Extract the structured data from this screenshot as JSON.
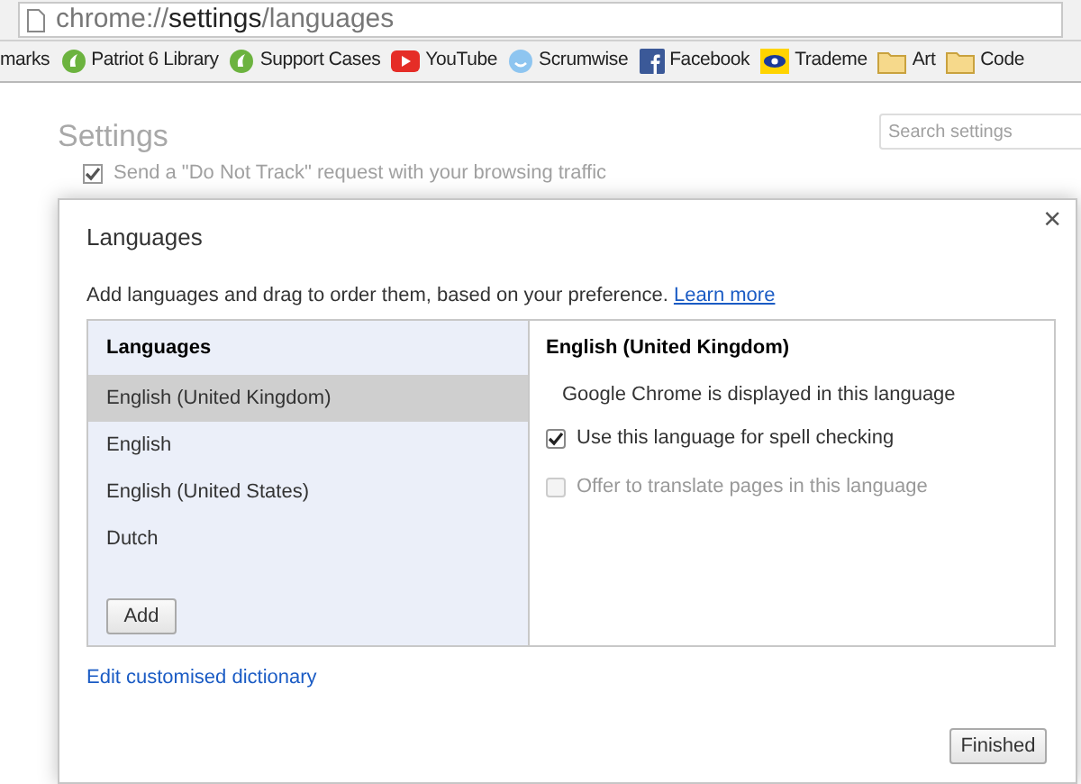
{
  "address_bar": {
    "scheme": "chrome://",
    "host": "settings",
    "path": "/languages"
  },
  "bookmarks": [
    {
      "label": "marks",
      "kind": "none"
    },
    {
      "label": "Patriot 6 Library",
      "kind": "green"
    },
    {
      "label": "Support Cases",
      "kind": "green"
    },
    {
      "label": "YouTube",
      "kind": "video"
    },
    {
      "label": "Scrumwise",
      "kind": "smiley"
    },
    {
      "label": "Facebook",
      "kind": "facebook"
    },
    {
      "label": "Trademe",
      "kind": "eye"
    },
    {
      "label": "Art",
      "kind": "folder"
    },
    {
      "label": "Code",
      "kind": "folder"
    }
  ],
  "settings_page": {
    "title": "Settings",
    "search": {
      "placeholder": "Search settings"
    },
    "do_not_track": {
      "label": "Send a \"Do Not Track\" request with your browsing traffic",
      "checked": true
    }
  },
  "dialog": {
    "title": "Languages",
    "close": "×",
    "description": "Add languages and drag to order them, based on your preference.",
    "learn_more": "Learn more",
    "list_header": "Languages",
    "languages": [
      {
        "label": "English (United Kingdom)",
        "selected": true
      },
      {
        "label": "English",
        "selected": false
      },
      {
        "label": "English (United States)",
        "selected": false
      },
      {
        "label": "Dutch",
        "selected": false
      }
    ],
    "add_button": "Add",
    "detail_header": "English (United Kingdom)",
    "detail_info": "Google Chrome is displayed in this language",
    "options": [
      {
        "label": "Use this language for spell checking",
        "checked": true,
        "disabled": false
      },
      {
        "label": "Offer to translate pages in this language",
        "checked": false,
        "disabled": true
      }
    ],
    "edit_dictionary": "Edit customised dictionary",
    "finished_button": "Finished"
  }
}
